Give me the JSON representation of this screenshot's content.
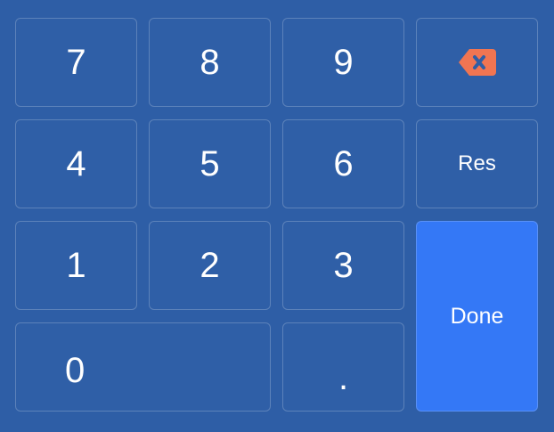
{
  "keypad": {
    "keys": {
      "k7": "7",
      "k8": "8",
      "k9": "9",
      "k4": "4",
      "k5": "5",
      "k6": "6",
      "k1": "1",
      "k2": "2",
      "k3": "3",
      "k0": "0",
      "dot": ".",
      "reset": "Res",
      "done": "Done"
    },
    "backspace_icon": "backspace-icon"
  },
  "colors": {
    "background": "#2e5ea6",
    "key_border": "rgba(255,255,255,0.22)",
    "done_accent": "#3478f6",
    "backspace_accent": "#f07552"
  }
}
